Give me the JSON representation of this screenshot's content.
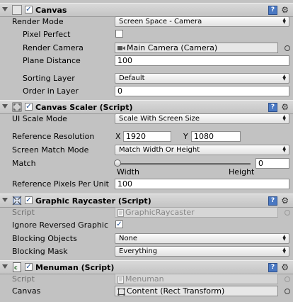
{
  "canvas": {
    "title": "Canvas",
    "render_mode_label": "Render Mode",
    "render_mode_value": "Screen Space - Camera",
    "pixel_perfect_label": "Pixel Perfect",
    "render_camera_label": "Render Camera",
    "render_camera_value": "Main Camera (Camera)",
    "plane_distance_label": "Plane Distance",
    "plane_distance_value": "100",
    "sorting_layer_label": "Sorting Layer",
    "sorting_layer_value": "Default",
    "order_in_layer_label": "Order in Layer",
    "order_in_layer_value": "0"
  },
  "canvas_scaler": {
    "title": "Canvas Scaler (Script)",
    "ui_scale_mode_label": "UI Scale Mode",
    "ui_scale_mode_value": "Scale With Screen Size",
    "ref_resolution_label": "Reference Resolution",
    "x_label": "X",
    "x_value": "1920",
    "y_label": "Y",
    "y_value": "1080",
    "screen_match_mode_label": "Screen Match Mode",
    "screen_match_mode_value": "Match Width Or Height",
    "match_label": "Match",
    "match_value": "0",
    "width_label": "Width",
    "height_label": "Height",
    "ref_ppu_label": "Reference Pixels Per Unit",
    "ref_ppu_value": "100"
  },
  "graphic_raycaster": {
    "title": "Graphic Raycaster (Script)",
    "script_label": "Script",
    "script_value": "GraphicRaycaster",
    "ignore_reversed_label": "Ignore Reversed Graphic",
    "blocking_objects_label": "Blocking Objects",
    "blocking_objects_value": "None",
    "blocking_mask_label": "Blocking Mask",
    "blocking_mask_value": "Everything"
  },
  "menuman": {
    "title": "Menuman (Script)",
    "script_label": "Script",
    "script_value": "Menuman",
    "canvas_label": "Canvas",
    "canvas_value": "Content (Rect Transform)"
  },
  "icons": {
    "help": "help-icon",
    "gear": "gear-icon",
    "check_glyph": "✓",
    "help_glyph": "?",
    "gear_glyph": "⚙",
    "dropdown_glyph": "▲▼"
  },
  "colors": {
    "panel_bg": "#c2c2c2",
    "header_bg": "#cfcfcf",
    "help_blue": "#4a78c2"
  }
}
